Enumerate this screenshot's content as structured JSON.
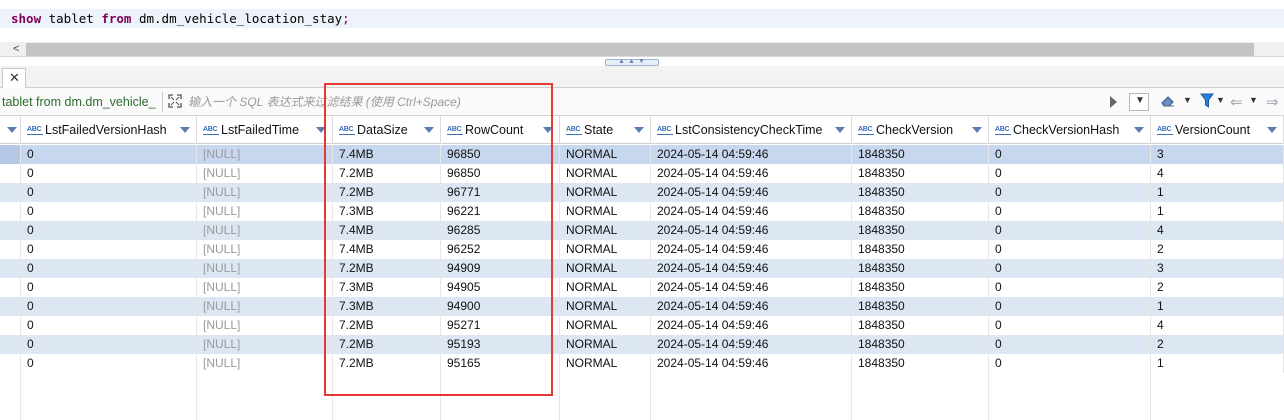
{
  "editor": {
    "sql": {
      "kw1": "show",
      "t1": " tablet ",
      "kw2": "from",
      "t2": " dm.dm_vehicle_location_stay",
      "semi": ";"
    },
    "scroll_left_arrow": "<"
  },
  "results_tab": {
    "close_icon": "close-icon"
  },
  "filter": {
    "query_label": "tablet from dm.dm_vehicle_",
    "placeholder": "输入一个 SQL 表达式来过滤结果 (使用 Ctrl+Space)"
  },
  "columns": [
    {
      "label": "LstFailedVersionHash",
      "icon": "abc-type-icon"
    },
    {
      "label": "LstFailedTime",
      "icon": "abc-type-icon"
    },
    {
      "label": "DataSize",
      "icon": "abc-type-icon"
    },
    {
      "label": "RowCount",
      "icon": "abc-type-icon"
    },
    {
      "label": "State",
      "icon": "abc-type-icon"
    },
    {
      "label": "LstConsistencyCheckTime",
      "icon": "abc-type-icon"
    },
    {
      "label": "CheckVersion",
      "icon": "abc-type-icon"
    },
    {
      "label": "CheckVersionHash",
      "icon": "abc-type-icon"
    },
    {
      "label": "VersionCount",
      "icon": "abc-type-icon"
    }
  ],
  "type_badge": "ABC",
  "rows": [
    [
      "0",
      "[NULL]",
      "7.4MB",
      "96850",
      "NORMAL",
      "2024-05-14 04:59:46",
      "1848350",
      "0",
      "3"
    ],
    [
      "0",
      "[NULL]",
      "7.2MB",
      "96850",
      "NORMAL",
      "2024-05-14 04:59:46",
      "1848350",
      "0",
      "4"
    ],
    [
      "0",
      "[NULL]",
      "7.2MB",
      "96771",
      "NORMAL",
      "2024-05-14 04:59:46",
      "1848350",
      "0",
      "1"
    ],
    [
      "0",
      "[NULL]",
      "7.3MB",
      "96221",
      "NORMAL",
      "2024-05-14 04:59:46",
      "1848350",
      "0",
      "1"
    ],
    [
      "0",
      "[NULL]",
      "7.4MB",
      "96285",
      "NORMAL",
      "2024-05-14 04:59:46",
      "1848350",
      "0",
      "4"
    ],
    [
      "0",
      "[NULL]",
      "7.4MB",
      "96252",
      "NORMAL",
      "2024-05-14 04:59:46",
      "1848350",
      "0",
      "2"
    ],
    [
      "0",
      "[NULL]",
      "7.2MB",
      "94909",
      "NORMAL",
      "2024-05-14 04:59:46",
      "1848350",
      "0",
      "3"
    ],
    [
      "0",
      "[NULL]",
      "7.3MB",
      "94905",
      "NORMAL",
      "2024-05-14 04:59:46",
      "1848350",
      "0",
      "2"
    ],
    [
      "0",
      "[NULL]",
      "7.3MB",
      "94900",
      "NORMAL",
      "2024-05-14 04:59:46",
      "1848350",
      "0",
      "1"
    ],
    [
      "0",
      "[NULL]",
      "7.2MB",
      "95271",
      "NORMAL",
      "2024-05-14 04:59:46",
      "1848350",
      "0",
      "4"
    ],
    [
      "0",
      "[NULL]",
      "7.2MB",
      "95193",
      "NORMAL",
      "2024-05-14 04:59:46",
      "1848350",
      "0",
      "2"
    ],
    [
      "0",
      "[NULL]",
      "7.2MB",
      "95165",
      "NORMAL",
      "2024-05-14 04:59:46",
      "1848350",
      "0",
      "1"
    ]
  ],
  "colors": {
    "highlight_border": "#e53935",
    "row_stripe": "#dde7f4",
    "query_label": "#2e6b30"
  }
}
